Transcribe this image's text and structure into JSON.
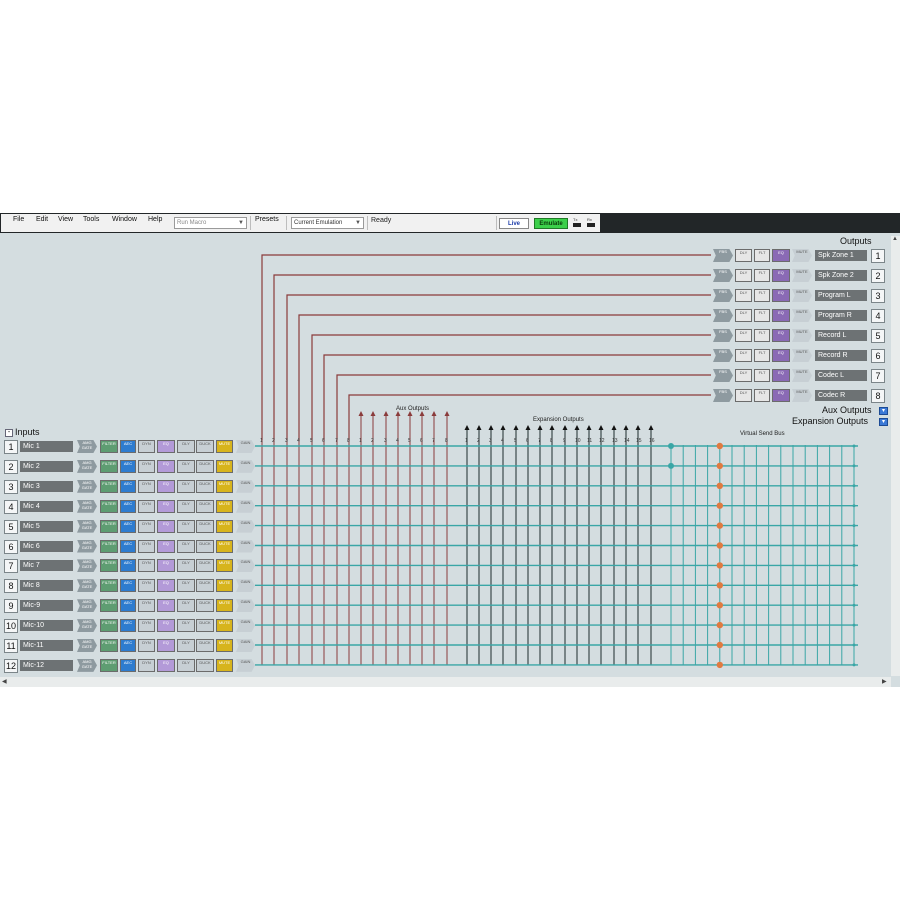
{
  "menubar": {
    "items": [
      "File",
      "Edit",
      "View",
      "Tools",
      "Window",
      "Help"
    ],
    "macro_combo": "Run Macro",
    "presets_label": "Presets",
    "presets_combo": "Current Emulation",
    "status": "Ready",
    "live_label": "Live",
    "emulate_label": "Emulate",
    "tx_label": "Tx",
    "rx_label": "Rx"
  },
  "outputs": {
    "title": "Outputs",
    "items": [
      {
        "num": "1",
        "label": "Spk Zone 1"
      },
      {
        "num": "2",
        "label": "Spk Zone 2"
      },
      {
        "num": "3",
        "label": "Program L"
      },
      {
        "num": "4",
        "label": "Program R"
      },
      {
        "num": "5",
        "label": "Record L"
      },
      {
        "num": "6",
        "label": "Record R"
      },
      {
        "num": "7",
        "label": "Codec L"
      },
      {
        "num": "8",
        "label": "Codec R"
      }
    ],
    "aux_title": "Aux Outputs",
    "exp_title": "Expansion Outputs"
  },
  "inputs": {
    "title": "Inputs",
    "items": [
      {
        "num": "1",
        "label": "Mic 1"
      },
      {
        "num": "2",
        "label": "Mic 2"
      },
      {
        "num": "3",
        "label": "Mic 3"
      },
      {
        "num": "4",
        "label": "Mic 4"
      },
      {
        "num": "5",
        "label": "Mic 5"
      },
      {
        "num": "6",
        "label": "Mic 6"
      },
      {
        "num": "7",
        "label": "Mic 7"
      },
      {
        "num": "8",
        "label": "Mic 8"
      },
      {
        "num": "9",
        "label": "Mic-9"
      },
      {
        "num": "10",
        "label": "Mic-10"
      },
      {
        "num": "11",
        "label": "Mic-11"
      },
      {
        "num": "12",
        "label": "Mic-12"
      }
    ]
  },
  "matrix": {
    "aux_label": "Aux Outputs",
    "exp_label": "Expansion Outputs",
    "vsb_label": "Virtual Send Bus",
    "output_cols": [
      "1",
      "2",
      "3",
      "4",
      "5",
      "6",
      "7",
      "8"
    ],
    "aux_cols": [
      "1",
      "2",
      "3",
      "4",
      "5",
      "6",
      "7",
      "8"
    ],
    "exp_cols": [
      "1",
      "2",
      "3",
      "4",
      "5",
      "6",
      "7",
      "8",
      "9",
      "10",
      "11",
      "12",
      "13",
      "14",
      "15",
      "16"
    ]
  },
  "colors": {
    "app_bg": "#d4dde0",
    "grid_teal": "#3aa6a6",
    "route_red": "#8a3b3b",
    "crosspoint_orange": "#e07a40",
    "live_blue": "#1a3aa8",
    "emulate_green": "#3ccf4a"
  },
  "chips": {
    "input": [
      {
        "label": "AMG GATE",
        "color": "#8e9aa0"
      },
      {
        "label": "FILTER",
        "color": "#5e9d72"
      },
      {
        "label": "AEC",
        "color": "#2e7ccf"
      },
      {
        "label": "DYN",
        "color": "#c7cfd4"
      },
      {
        "label": "EQ",
        "color": "#b39ad8"
      },
      {
        "label": "DLY",
        "color": "#c7cfd4"
      },
      {
        "label": "DUCK",
        "color": "#c7cfd4"
      },
      {
        "label": "MUTE",
        "color": "#d7b41c"
      },
      {
        "label": "GAIN",
        "color": "#c7cfd4"
      }
    ],
    "output": [
      {
        "label": "FBS",
        "color": "#8e9aa0"
      },
      {
        "label": "DLY",
        "color": "#e6e6e6"
      },
      {
        "label": "FLT",
        "color": "#e6e6e6"
      },
      {
        "label": "EQ",
        "color": "#8a6ab5"
      },
      {
        "label": "MUTE",
        "color": "#c7cfd4"
      }
    ]
  }
}
